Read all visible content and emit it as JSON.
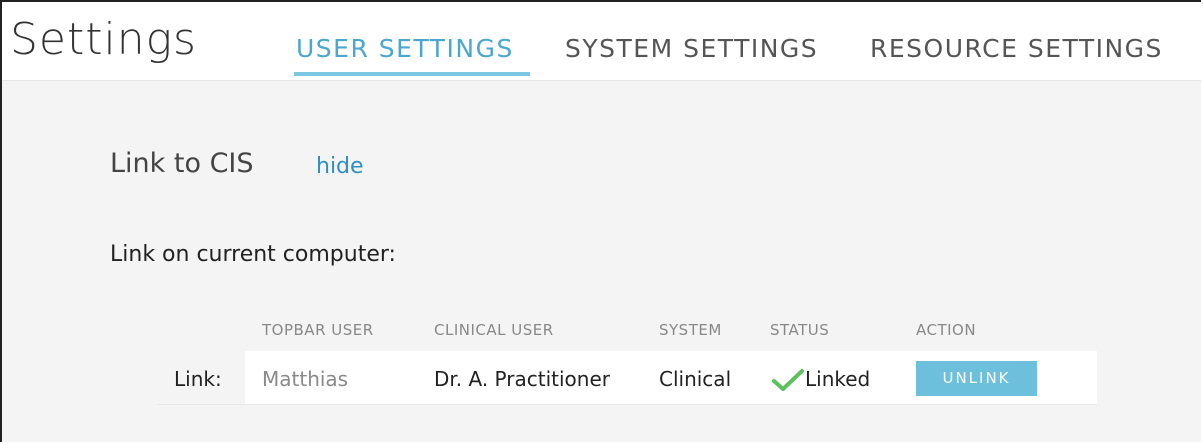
{
  "header": {
    "title": "Settings",
    "tabs": [
      {
        "label": "USER SETTINGS",
        "active": true
      },
      {
        "label": "SYSTEM SETTINGS",
        "active": false
      },
      {
        "label": "RESOURCE SETTINGS",
        "active": false
      }
    ]
  },
  "section": {
    "title": "Link to CIS",
    "hide_label": "hide",
    "subheading": "Link on current computer:"
  },
  "table": {
    "columns": [
      "TOPBAR USER",
      "CLINICAL USER",
      "SYSTEM",
      "STATUS",
      "ACTION"
    ],
    "row": {
      "label": "Link:",
      "topbar_user": "Matthias",
      "clinical_user": "Dr. A. Practitioner",
      "system": "Clinical",
      "status_icon": "check-icon",
      "status": "Linked",
      "action": "UNLINK"
    }
  },
  "colors": {
    "accent": "#4aa7cf",
    "button": "#6cc0db",
    "status_ok": "#5cc15c"
  }
}
